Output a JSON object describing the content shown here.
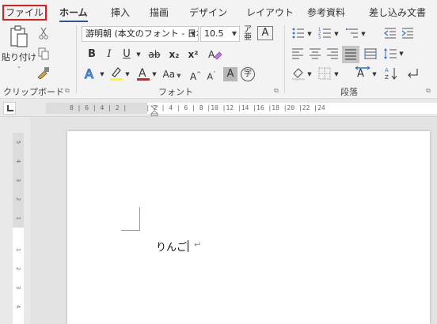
{
  "tabs": {
    "file": "ファイル",
    "home": "ホーム",
    "insert": "挿入",
    "draw": "描画",
    "design": "デザイン",
    "layout": "レイアウト",
    "references": "参考資料",
    "mailings": "差し込み文書"
  },
  "clipboard": {
    "paste_label": "貼り付け",
    "group_label": "クリップボード"
  },
  "font": {
    "name": "游明朝 (本文のフォント - 日本",
    "size": "10.5",
    "bold": "B",
    "italic": "I",
    "underline": "U",
    "strikethrough": "ab",
    "subscript": "x₂",
    "superscript": "x²",
    "change_case": "Aa",
    "grow": "A",
    "shrink": "A",
    "char_shading": "A",
    "enclose": "字",
    "group_label": "フォント"
  },
  "paragraph": {
    "group_label": "段落"
  },
  "ruler": {
    "marks": "8 | 6 | 4 | 2 |     | 2 | 4 | 6 | 8 |10 |12 |14 |16 |18 |20 |22 |24"
  },
  "vruler": {
    "marks": [
      "5",
      "4",
      "3",
      "2",
      "1",
      "1",
      "2",
      "3",
      "4"
    ]
  },
  "document": {
    "text": "りんご",
    "paragraph_mark": "↵"
  },
  "colors": {
    "accent": "#2b579a",
    "highlight": "#e21c1c",
    "font_color_bar": "#e11d1d",
    "highlighter_bar": "#ffff00"
  }
}
